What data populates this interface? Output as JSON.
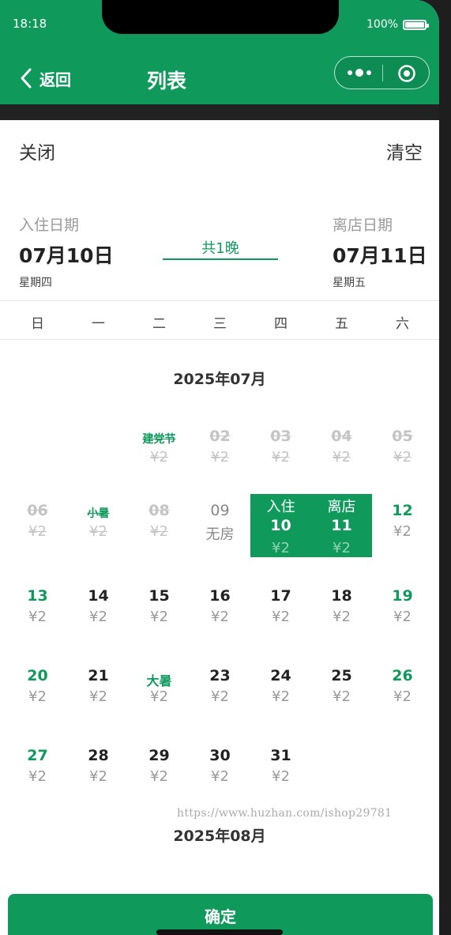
{
  "status_bar": {
    "time": "18:18",
    "battery": "100%"
  },
  "nav": {
    "back_label": "返回",
    "title": "列表"
  },
  "actions": {
    "close_label": "关闭",
    "clear_label": "清空"
  },
  "checkin": {
    "label": "入住日期",
    "date": "07月10日",
    "weekday": "星期四"
  },
  "checkout": {
    "label": "离店日期",
    "date": "07月11日",
    "weekday": "星期五"
  },
  "nights": "共1晚",
  "weekdays": [
    "日",
    "一",
    "二",
    "三",
    "四",
    "五",
    "六"
  ],
  "month_title": "2025年07月",
  "next_month_title": "2025年08月",
  "watermark": "https://www.huzhan.com/ishop29781",
  "confirm_label": "确定",
  "colors": {
    "primary": "#0f9a5c",
    "disabled": "#c4c4c4"
  },
  "days": [
    {
      "col": 2,
      "row": 0,
      "label": "建党节",
      "price": "¥2",
      "state": "past",
      "fest": true
    },
    {
      "col": 3,
      "row": 0,
      "label": "02",
      "price": "¥2",
      "state": "past"
    },
    {
      "col": 4,
      "row": 0,
      "label": "03",
      "price": "¥2",
      "state": "past"
    },
    {
      "col": 5,
      "row": 0,
      "label": "04",
      "price": "¥2",
      "state": "past"
    },
    {
      "col": 6,
      "row": 0,
      "label": "05",
      "price": "¥2",
      "state": "past"
    },
    {
      "col": 0,
      "row": 1,
      "label": "06",
      "price": "¥2",
      "state": "past"
    },
    {
      "col": 1,
      "row": 1,
      "label": "小暑",
      "price": "¥2",
      "state": "past",
      "fest": true
    },
    {
      "col": 2,
      "row": 1,
      "label": "08",
      "price": "¥2",
      "state": "past"
    },
    {
      "col": 3,
      "row": 1,
      "label": "09",
      "price": "无房",
      "state": "nohouse"
    },
    {
      "col": 4,
      "row": 1,
      "label": "10",
      "price": "¥2",
      "state": "sel",
      "tag": "入住"
    },
    {
      "col": 5,
      "row": 1,
      "label": "11",
      "price": "¥2",
      "state": "sel",
      "tag": "离店"
    },
    {
      "col": 6,
      "row": 1,
      "label": "12",
      "price": "¥2",
      "state": "weekend"
    },
    {
      "col": 0,
      "row": 2,
      "label": "13",
      "price": "¥2",
      "state": "weekend"
    },
    {
      "col": 1,
      "row": 2,
      "label": "14",
      "price": "¥2",
      "state": "normal"
    },
    {
      "col": 2,
      "row": 2,
      "label": "15",
      "price": "¥2",
      "state": "normal"
    },
    {
      "col": 3,
      "row": 2,
      "label": "16",
      "price": "¥2",
      "state": "normal"
    },
    {
      "col": 4,
      "row": 2,
      "label": "17",
      "price": "¥2",
      "state": "normal"
    },
    {
      "col": 5,
      "row": 2,
      "label": "18",
      "price": "¥2",
      "state": "normal"
    },
    {
      "col": 6,
      "row": 2,
      "label": "19",
      "price": "¥2",
      "state": "weekend"
    },
    {
      "col": 0,
      "row": 3,
      "label": "20",
      "price": "¥2",
      "state": "weekend"
    },
    {
      "col": 1,
      "row": 3,
      "label": "21",
      "price": "¥2",
      "state": "normal"
    },
    {
      "col": 2,
      "row": 3,
      "label": "大暑",
      "price": "¥2",
      "state": "normal",
      "fest": true
    },
    {
      "col": 3,
      "row": 3,
      "label": "23",
      "price": "¥2",
      "state": "normal"
    },
    {
      "col": 4,
      "row": 3,
      "label": "24",
      "price": "¥2",
      "state": "normal"
    },
    {
      "col": 5,
      "row": 3,
      "label": "25",
      "price": "¥2",
      "state": "normal"
    },
    {
      "col": 6,
      "row": 3,
      "label": "26",
      "price": "¥2",
      "state": "weekend"
    },
    {
      "col": 0,
      "row": 4,
      "label": "27",
      "price": "¥2",
      "state": "weekend"
    },
    {
      "col": 1,
      "row": 4,
      "label": "28",
      "price": "¥2",
      "state": "normal"
    },
    {
      "col": 2,
      "row": 4,
      "label": "29",
      "price": "¥2",
      "state": "normal"
    },
    {
      "col": 3,
      "row": 4,
      "label": "30",
      "price": "¥2",
      "state": "normal"
    },
    {
      "col": 4,
      "row": 4,
      "label": "31",
      "price": "¥2",
      "state": "normal"
    }
  ]
}
